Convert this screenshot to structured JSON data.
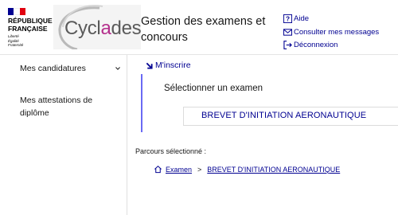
{
  "header": {
    "gov_name": [
      "RÉPUBLIQUE",
      "FRANÇAISE"
    ],
    "gov_motto": [
      "Liberté",
      "Égalité",
      "Fraternité"
    ],
    "logo": {
      "prefix": "Cycl",
      "accent": "a",
      "suffix": "des"
    },
    "title": "Gestion des examens et concours",
    "links": [
      {
        "label": "Aide",
        "icon": "help-icon"
      },
      {
        "label": "Consulter mes messages",
        "icon": "mail-icon"
      },
      {
        "label": "Déconnexion",
        "icon": "logout-icon"
      }
    ]
  },
  "sidebar": {
    "items": [
      {
        "label": "Mes candidatures",
        "icon": "chevron-down-icon"
      },
      {
        "label": "Mes attestations de diplôme"
      }
    ]
  },
  "main": {
    "section_link": "M'inscrire",
    "select_title": "Sélectionner un examen",
    "exam_option": "BREVET D'INITIATION AERONAUTIQUE",
    "parcours_label": "Parcours sélectionné :",
    "breadcrumb": {
      "items": [
        "Examen",
        "BREVET D'INITIATION AERONAUTIQUE"
      ],
      "separator": ">"
    }
  },
  "colors": {
    "brand_blue": "#000091",
    "flag_red": "#e1000f",
    "logo_accent": "#b42f8c",
    "section_bar": "#6a6af4"
  }
}
